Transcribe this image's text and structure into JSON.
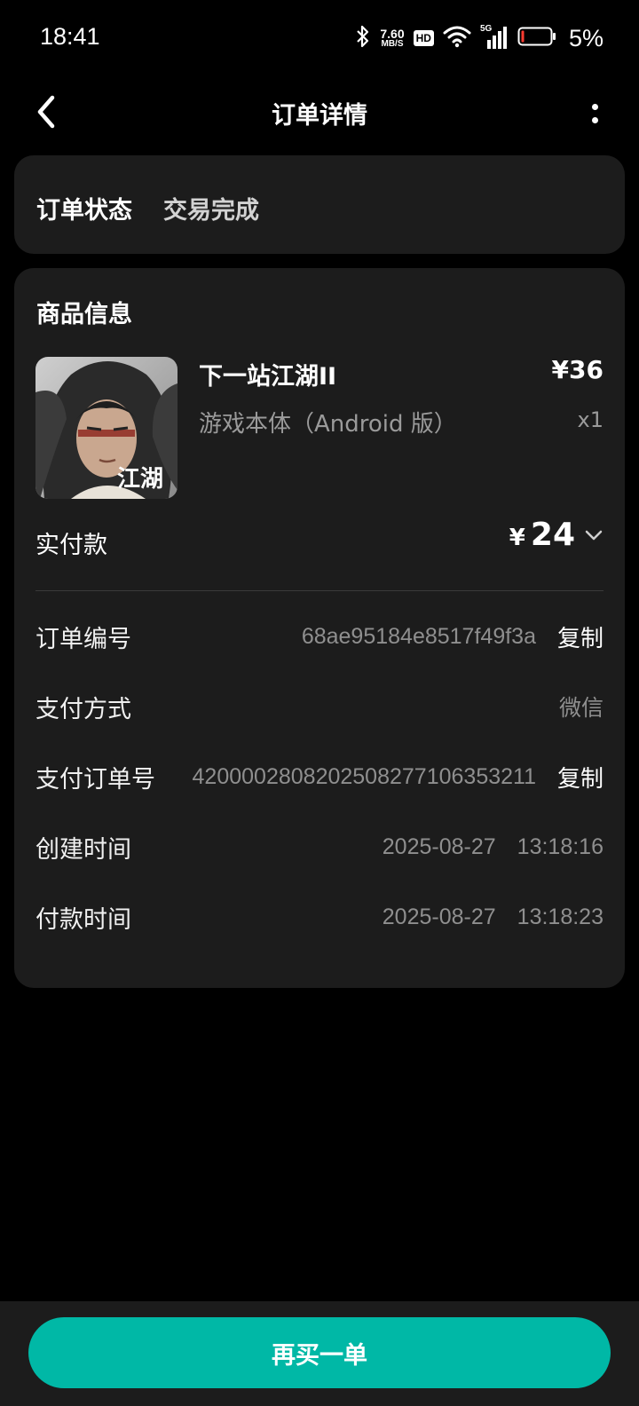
{
  "status_bar": {
    "time": "18:41",
    "net_speed_value": "7.60",
    "net_speed_unit": "MB/S",
    "hd_badge": "HD",
    "signal_label": "5G",
    "battery_percent": "5%",
    "icons": [
      "bluetooth-icon",
      "hd-icon",
      "wifi-icon",
      "signal-icon",
      "battery-icon"
    ]
  },
  "nav": {
    "title": "订单详情",
    "back_icon": "chevron-left-icon",
    "more_icon": "more-vertical-icon"
  },
  "order_status": {
    "label": "订单状态",
    "value": "交易完成"
  },
  "product_section": {
    "title": "商品信息",
    "product": {
      "name": "下一站江湖II",
      "price": "¥36",
      "variant": "游戏本体（Android 版）",
      "quantity": "x1",
      "thumb_text": "江湖"
    },
    "paid": {
      "label": "实付款",
      "currency": "¥",
      "amount": "24",
      "expand_icon": "chevron-down-icon"
    }
  },
  "details": {
    "order_no": {
      "label": "订单编号",
      "value": "68ae95184e8517f49f3a",
      "copy_label": "复制"
    },
    "pay_method": {
      "label": "支付方式",
      "value": "微信"
    },
    "pay_order_no": {
      "label": "支付订单号",
      "value": "4200002808202508277106353211",
      "copy_label": "复制"
    },
    "created": {
      "label": "创建时间",
      "date": "2025-08-27",
      "time": "13:18:16"
    },
    "paid_time": {
      "label": "付款时间",
      "date": "2025-08-27",
      "time": "13:18:23"
    }
  },
  "footer": {
    "rebuy_label": "再买一单"
  },
  "colors": {
    "background": "#000000",
    "card": "#1c1c1c",
    "accent": "#00b8a6",
    "muted_text": "#8f8f8f"
  }
}
